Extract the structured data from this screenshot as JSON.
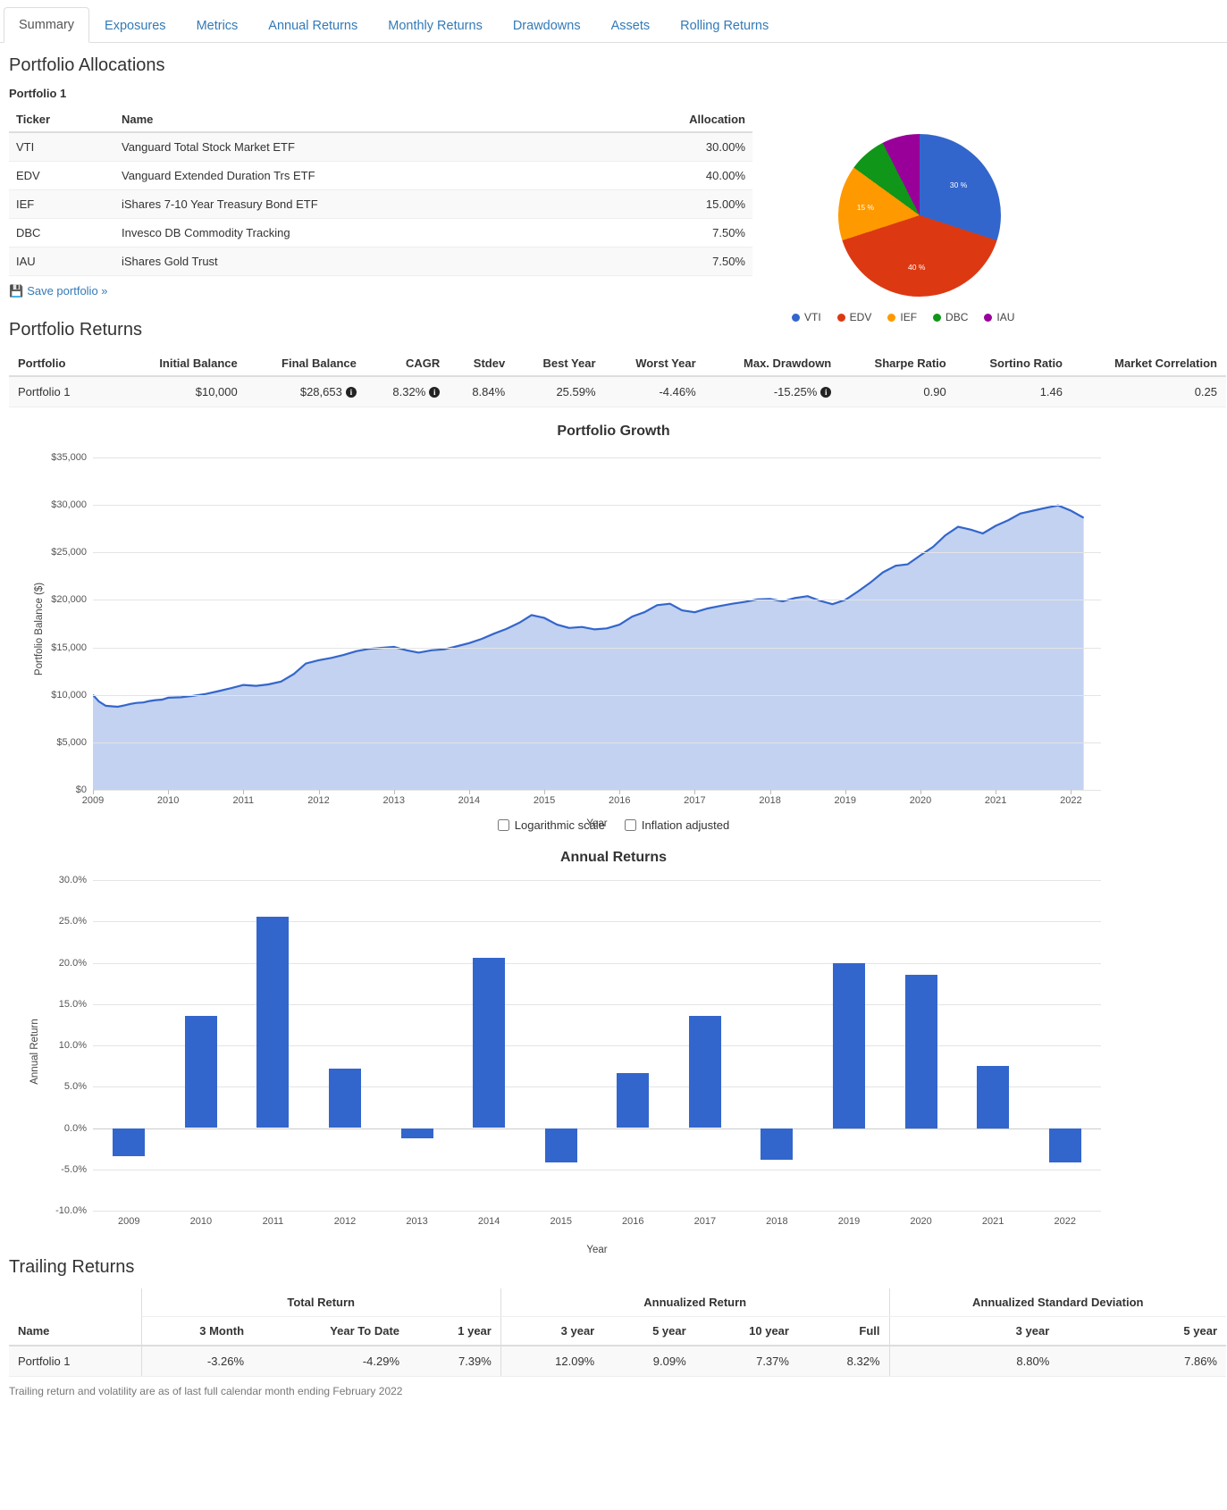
{
  "tabs": [
    {
      "label": "Summary",
      "active": true
    },
    {
      "label": "Exposures",
      "active": false
    },
    {
      "label": "Metrics",
      "active": false
    },
    {
      "label": "Annual Returns",
      "active": false
    },
    {
      "label": "Monthly Returns",
      "active": false
    },
    {
      "label": "Drawdowns",
      "active": false
    },
    {
      "label": "Assets",
      "active": false
    },
    {
      "label": "Rolling Returns",
      "active": false
    }
  ],
  "allocations": {
    "heading": "Portfolio Allocations",
    "portfolio_name": "Portfolio 1",
    "columns": [
      "Ticker",
      "Name",
      "Allocation"
    ],
    "rows": [
      {
        "ticker": "VTI",
        "name": "Vanguard Total Stock Market ETF",
        "allocation": "30.00%"
      },
      {
        "ticker": "EDV",
        "name": "Vanguard Extended Duration Trs ETF",
        "allocation": "40.00%"
      },
      {
        "ticker": "IEF",
        "name": "iShares 7-10 Year Treasury Bond ETF",
        "allocation": "15.00%"
      },
      {
        "ticker": "DBC",
        "name": "Invesco DB Commodity Tracking",
        "allocation": "7.50%"
      },
      {
        "ticker": "IAU",
        "name": "iShares Gold Trust",
        "allocation": "7.50%"
      }
    ],
    "save_link": "Save portfolio »",
    "save_icon": "save-icon"
  },
  "returns": {
    "heading": "Portfolio Returns",
    "columns": [
      "Portfolio",
      "Initial Balance",
      "Final Balance",
      "CAGR",
      "Stdev",
      "Best Year",
      "Worst Year",
      "Max. Drawdown",
      "Sharpe Ratio",
      "Sortino Ratio",
      "Market Correlation"
    ],
    "row": {
      "portfolio": "Portfolio 1",
      "initial_balance": "$10,000",
      "final_balance": "$28,653",
      "cagr": "8.32%",
      "stdev": "8.84%",
      "best_year": "25.59%",
      "worst_year": "-4.46%",
      "max_drawdown": "-15.25%",
      "sharpe_ratio": "0.90",
      "sortino_ratio": "1.46",
      "market_correlation": "0.25"
    }
  },
  "growth_controls": {
    "log_scale": "Logarithmic scale",
    "inflation_adjusted": "Inflation adjusted"
  },
  "trailing": {
    "heading": "Trailing Returns",
    "group_headers": [
      "Total Return",
      "Annualized Return",
      "Annualized Standard Deviation"
    ],
    "columns": [
      "Name",
      "3 Month",
      "Year To Date",
      "1 year",
      "3 year",
      "5 year",
      "10 year",
      "Full",
      "3 year",
      "5 year"
    ],
    "row": {
      "name": "Portfolio 1",
      "three_month": "-3.26%",
      "ytd": "-4.29%",
      "one_year": "7.39%",
      "three_year": "12.09%",
      "five_year": "9.09%",
      "ten_year": "7.37%",
      "full": "8.32%",
      "sd_three_year": "8.80%",
      "sd_five_year": "7.86%"
    },
    "footnote": "Trailing return and volatility are as of last full calendar month ending February 2022"
  },
  "chart_data": [
    {
      "type": "pie",
      "title": "",
      "legend_position": "bottom",
      "labels": [
        "VTI",
        "EDV",
        "IEF",
        "DBC",
        "IAU"
      ],
      "values": [
        30,
        40,
        15,
        7.5,
        7.5
      ],
      "value_labels": [
        "30 %",
        "40 %",
        "15 %",
        "",
        ""
      ],
      "colors": [
        "#3366cc",
        "#dc3912",
        "#ff9900",
        "#109618",
        "#990099"
      ]
    },
    {
      "type": "area",
      "title": "Portfolio Growth",
      "xlabel": "Year",
      "ylabel": "Portfolio Balance ($)",
      "ylim": [
        0,
        35000
      ],
      "yticks": [
        "$0",
        "$5,000",
        "$10,000",
        "$15,000",
        "$20,000",
        "$25,000",
        "$30,000",
        "$35,000"
      ],
      "xticks": [
        "2009",
        "2010",
        "2011",
        "2012",
        "2013",
        "2014",
        "2015",
        "2016",
        "2017",
        "2018",
        "2019",
        "2020",
        "2021",
        "2022"
      ],
      "grid": true,
      "line_color": "#3366cc",
      "fill_color": "#c3d2f0",
      "series": [
        {
          "name": "Portfolio 1",
          "x": [
            2009.0,
            2009.08,
            2009.17,
            2009.25,
            2009.33,
            2009.42,
            2009.5,
            2009.58,
            2009.67,
            2009.75,
            2009.83,
            2009.92,
            2010.0,
            2010.17,
            2010.33,
            2010.5,
            2010.67,
            2010.83,
            2011.0,
            2011.17,
            2011.33,
            2011.5,
            2011.67,
            2011.83,
            2012.0,
            2012.17,
            2012.33,
            2012.5,
            2012.67,
            2012.83,
            2013.0,
            2013.17,
            2013.33,
            2013.5,
            2013.67,
            2013.83,
            2014.0,
            2014.17,
            2014.33,
            2014.5,
            2014.67,
            2014.83,
            2015.0,
            2015.17,
            2015.33,
            2015.5,
            2015.67,
            2015.83,
            2016.0,
            2016.17,
            2016.33,
            2016.5,
            2016.67,
            2016.83,
            2017.0,
            2017.17,
            2017.33,
            2017.5,
            2017.67,
            2017.83,
            2018.0,
            2018.17,
            2018.33,
            2018.5,
            2018.67,
            2018.83,
            2019.0,
            2019.17,
            2019.33,
            2019.5,
            2019.67,
            2019.83,
            2020.0,
            2020.17,
            2020.33,
            2020.5,
            2020.67,
            2020.83,
            2021.0,
            2021.17,
            2021.33,
            2021.5,
            2021.67,
            2021.83,
            2022.0,
            2022.17
          ],
          "values": [
            10000,
            9300,
            8850,
            8800,
            8750,
            8900,
            9050,
            9150,
            9200,
            9350,
            9450,
            9500,
            9700,
            9750,
            9900,
            10100,
            10400,
            10700,
            11050,
            10950,
            11100,
            11400,
            12200,
            13300,
            13650,
            13900,
            14200,
            14600,
            14850,
            14950,
            15050,
            14700,
            14450,
            14700,
            14800,
            15100,
            15450,
            15900,
            16450,
            16950,
            17600,
            18400,
            18100,
            17400,
            17050,
            17150,
            16900,
            17000,
            17400,
            18250,
            18700,
            19450,
            19600,
            18900,
            18700,
            19100,
            19350,
            19600,
            19800,
            20050,
            20100,
            19850,
            20200,
            20400,
            19900,
            19550,
            20000,
            20900,
            21800,
            22900,
            23600,
            23750,
            24700,
            25600,
            26800,
            27700,
            27400,
            27000,
            27800,
            28400,
            29100,
            29400,
            29700,
            29950,
            29400,
            28653
          ]
        }
      ]
    },
    {
      "type": "bar",
      "title": "Annual Returns",
      "xlabel": "Year",
      "ylabel": "Annual Return",
      "ylim": [
        -10,
        30
      ],
      "yticks": [
        "-10.0%",
        "-5.0%",
        "0.0%",
        "5.0%",
        "10.0%",
        "15.0%",
        "20.0%",
        "25.0%",
        "30.0%"
      ],
      "categories": [
        "2009",
        "2010",
        "2011",
        "2012",
        "2013",
        "2014",
        "2015",
        "2016",
        "2017",
        "2018",
        "2019",
        "2020",
        "2021",
        "2022"
      ],
      "bar_color": "#3366cc",
      "grid": true,
      "series": [
        {
          "name": "Portfolio 1",
          "values": [
            -3.4,
            13.6,
            25.6,
            7.2,
            -1.2,
            20.6,
            -4.2,
            6.6,
            13.6,
            -3.8,
            20.0,
            18.5,
            7.5,
            -4.2
          ]
        }
      ]
    }
  ]
}
